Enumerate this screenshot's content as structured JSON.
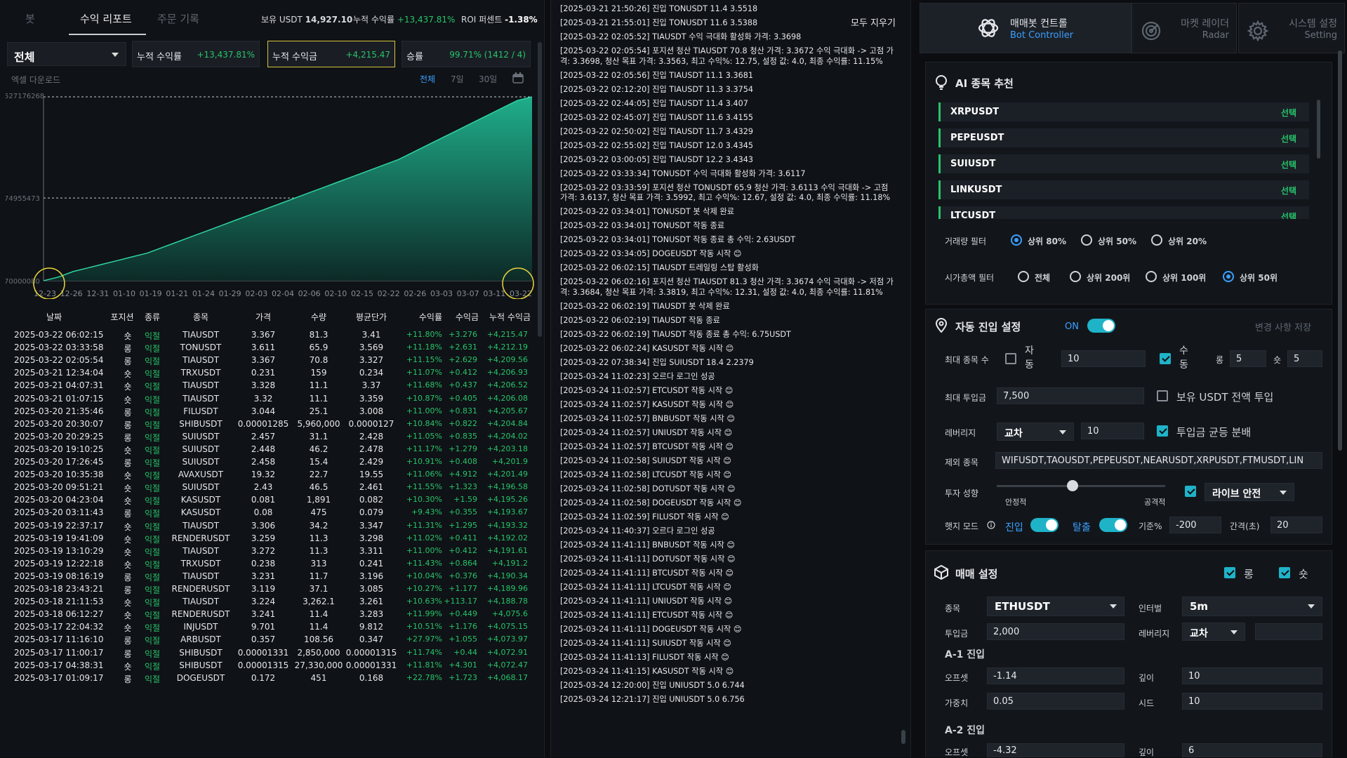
{
  "left": {
    "tabs": [
      "봇",
      "수익 리포트",
      "주문 기록"
    ],
    "summary": {
      "usdt_label": "보유 USDT",
      "usdt_value": "14,927.10",
      "cum_rate_label": "누적 수익률",
      "cum_rate_value": "+13,437.81%",
      "roi_label": "ROI 퍼센트",
      "roi_value": "-1.38%"
    },
    "filter_value": "전체",
    "stats": [
      {
        "label": "누적 수익률",
        "value": "+13,437.81%"
      },
      {
        "label": "누적 수익금",
        "value": "+4,215.47"
      },
      {
        "label": "승률",
        "value": "99.71% (1412 / 4)"
      }
    ],
    "excel_label": "엑셀 다운로드",
    "ranges": [
      "전체",
      "7일",
      "30일"
    ],
    "table_headers": [
      "날짜",
      "포지션",
      "종류",
      "종목",
      "가격",
      "수량",
      "평균단가",
      "수익률",
      "수익금",
      "누적 수익금"
    ],
    "rows": [
      [
        "2025-03-22 06:02:15",
        "숏",
        "익절",
        "TIAUSDT",
        "3.367",
        "81.3",
        "3.41",
        "+11.80%",
        "+3.276",
        "+4,215.47"
      ],
      [
        "2025-03-22 03:33:58",
        "롱",
        "익절",
        "TONUSDT",
        "3.611",
        "65.9",
        "3.569",
        "+11.18%",
        "+2.631",
        "+4,212.19"
      ],
      [
        "2025-03-22 02:05:54",
        "롱",
        "익절",
        "TIAUSDT",
        "3.367",
        "70.8",
        "3.327",
        "+11.15%",
        "+2.629",
        "+4,209.56"
      ],
      [
        "2025-03-21 12:34:04",
        "숏",
        "익절",
        "TRXUSDT",
        "0.231",
        "159",
        "0.234",
        "+11.07%",
        "+0.412",
        "+4,206.93"
      ],
      [
        "2025-03-21 04:07:31",
        "숏",
        "익절",
        "TIAUSDT",
        "3.328",
        "11.1",
        "3.37",
        "+11.68%",
        "+0.437",
        "+4,206.52"
      ],
      [
        "2025-03-21 01:07:15",
        "숏",
        "익절",
        "TIAUSDT",
        "3.32",
        "11.1",
        "3.359",
        "+10.87%",
        "+0.405",
        "+4,206.08"
      ],
      [
        "2025-03-20 21:35:46",
        "롱",
        "익절",
        "FILUSDT",
        "3.044",
        "25.1",
        "3.008",
        "+11.00%",
        "+0.831",
        "+4,205.67"
      ],
      [
        "2025-03-20 20:30:07",
        "롱",
        "익절",
        "SHIBUSDT",
        "0.00001285",
        "5,960,000",
        "0.0000127",
        "+10.84%",
        "+0.822",
        "+4,204.84"
      ],
      [
        "2025-03-20 20:29:25",
        "롱",
        "익절",
        "SUIUSDT",
        "2.457",
        "31.1",
        "2.428",
        "+11.05%",
        "+0.835",
        "+4,204.02"
      ],
      [
        "2025-03-20 19:10:25",
        "숏",
        "익절",
        "SUIUSDT",
        "2.448",
        "46.2",
        "2.478",
        "+11.17%",
        "+1.279",
        "+4,203.18"
      ],
      [
        "2025-03-20 17:26:45",
        "롱",
        "익절",
        "SUIUSDT",
        "2.458",
        "15.4",
        "2.429",
        "+10.91%",
        "+0.408",
        "+4,201.9"
      ],
      [
        "2025-03-20 10:35:38",
        "숏",
        "익절",
        "AVAXUSDT",
        "19.32",
        "22.7",
        "19.55",
        "+11.06%",
        "+4.912",
        "+4,201.49"
      ],
      [
        "2025-03-20 09:51:21",
        "숏",
        "익절",
        "SUIUSDT",
        "2.43",
        "46.5",
        "2.461",
        "+11.55%",
        "+1.323",
        "+4,196.58"
      ],
      [
        "2025-03-20 04:23:04",
        "숏",
        "익절",
        "KASUSDT",
        "0.081",
        "1,891",
        "0.082",
        "+10.30%",
        "+1.59",
        "+4,195.26"
      ],
      [
        "2025-03-20 03:11:43",
        "롱",
        "익절",
        "KASUSDT",
        "0.08",
        "475",
        "0.079",
        "+9.43%",
        "+0.355",
        "+4,193.67"
      ],
      [
        "2025-03-19 22:37:17",
        "숏",
        "익절",
        "TIAUSDT",
        "3.306",
        "34.2",
        "3.347",
        "+11.31%",
        "+1.295",
        "+4,193.32"
      ],
      [
        "2025-03-19 19:41:09",
        "숏",
        "익절",
        "RENDERUSDT",
        "3.259",
        "11.3",
        "3.298",
        "+11.02%",
        "+0.411",
        "+4,192.02"
      ],
      [
        "2025-03-19 13:10:29",
        "숏",
        "익절",
        "TIAUSDT",
        "3.272",
        "11.3",
        "3.311",
        "+11.00%",
        "+0.412",
        "+4,191.61"
      ],
      [
        "2025-03-19 12:22:18",
        "숏",
        "익절",
        "TRXUSDT",
        "0.238",
        "313",
        "0.241",
        "+11.43%",
        "+0.864",
        "+4,191.2"
      ],
      [
        "2025-03-19 08:16:19",
        "롱",
        "익절",
        "TIAUSDT",
        "3.231",
        "11.7",
        "3.196",
        "+10.04%",
        "+0.376",
        "+4,190.34"
      ],
      [
        "2025-03-18 23:43:21",
        "롱",
        "익절",
        "RENDERUSDT",
        "3.119",
        "37.1",
        "3.085",
        "+10.27%",
        "+1.177",
        "+4,189.96"
      ],
      [
        "2025-03-18 21:11:53",
        "숏",
        "익절",
        "TIAUSDT",
        "3.224",
        "3,262.1",
        "3.261",
        "+10.63%",
        "+113.17",
        "+4,188.78"
      ],
      [
        "2025-03-18 06:12:27",
        "숏",
        "익절",
        "RENDERUSDT",
        "3.241",
        "11.4",
        "3.283",
        "+11.99%",
        "+0.449",
        "+4,075.6"
      ],
      [
        "2025-03-17 22:04:32",
        "숏",
        "익절",
        "INJUSDT",
        "9.701",
        "11.4",
        "9.812",
        "+10.51%",
        "+1.176",
        "+4,075.15"
      ],
      [
        "2025-03-17 11:16:10",
        "롱",
        "익절",
        "ARBUSDT",
        "0.357",
        "108.56",
        "0.347",
        "+27.97%",
        "+1.055",
        "+4,073.97"
      ],
      [
        "2025-03-17 11:00:17",
        "롱",
        "익절",
        "SHIBUSDT",
        "0.00001331",
        "2,850,000",
        "0.00001315",
        "+11.74%",
        "+0.44",
        "+4,072.91"
      ],
      [
        "2025-03-17 04:38:31",
        "숏",
        "익절",
        "SHIBUSDT",
        "0.00001315",
        "27,330,000",
        "0.00001331",
        "+11.81%",
        "+4.301",
        "+4,072.47"
      ],
      [
        "2025-03-17 01:09:17",
        "롱",
        "익절",
        "DOGEUSDT",
        "0.172",
        "451",
        "0.168",
        "+22.78%",
        "+1.723",
        "+4,068.17"
      ]
    ]
  },
  "chart_data": {
    "type": "area",
    "title": "",
    "xlabel": "",
    "ylabel": "",
    "y_ticks": [
      "527176268",
      "74955473",
      "70000080"
    ],
    "ylim": [
      70000080,
      527176268
    ],
    "x_ticks": [
      "12-23",
      "12-26",
      "12-31",
      "01-10",
      "01-19",
      "01-21",
      "01-24",
      "01-29",
      "02-03",
      "02-04",
      "02-06",
      "02-10",
      "02-15",
      "02-22",
      "02-26",
      "03-03",
      "03-07",
      "03-11",
      "03-22"
    ],
    "values": [
      0.0,
      0.02,
      0.05,
      0.07,
      0.09,
      0.11,
      0.13,
      0.15,
      0.18,
      0.21,
      0.24,
      0.27,
      0.3,
      0.33,
      0.36,
      0.39,
      0.42,
      0.45,
      0.48,
      0.51,
      0.54,
      0.57,
      0.6,
      0.63,
      0.66,
      0.7,
      0.74,
      0.78,
      0.82,
      0.86,
      0.9,
      0.94,
      0.98,
      1.0
    ],
    "values_unit": "fraction of y range",
    "grid": true,
    "color": "#1fa383"
  },
  "mid": {
    "clear_label": "모두 지우기",
    "logs": [
      "[2025-03-21 21:50:26] 진입 TONUSDT 11.4 3.5518",
      "[2025-03-21 21:55:01] 진입 TONUSDT 11.6 3.5388",
      "[2025-03-22 02:05:52] TIAUSDT 수익 극대화 활성화 가격: 3.3698",
      "[2025-03-22 02:05:54] 포지션 청산 TIAUSDT 70.8 청산 가격: 3.3672 수익 극대화 -> 고점 가격: 3.3698, 청산 목표 가격: 3.3563, 최고 수익%: 12.75, 설정 값: 4.0, 최종 수익률: 11.15%",
      "[2025-03-22 02:05:56] 진입 TIAUSDT 11.1 3.3681",
      "[2025-03-22 02:12:20] 진입 TIAUSDT 11.3 3.3754",
      "[2025-03-22 02:44:05] 진입 TIAUSDT 11.4 3.407",
      "[2025-03-22 02:45:07] 진입 TIAUSDT 11.6 3.4155",
      "[2025-03-22 02:50:02] 진입 TIAUSDT 11.7 3.4329",
      "[2025-03-22 02:55:02] 진입 TIAUSDT 12.0 3.4345",
      "[2025-03-22 03:00:05] 진입 TIAUSDT 12.2 3.4343",
      "[2025-03-22 03:33:34] TONUSDT 수익 극대화 활성화 가격: 3.6117",
      "[2025-03-22 03:33:59] 포지션 청산 TONUSDT 65.9 청산 가격: 3.6113 수익 극대화 -> 고점 가격: 3.6137, 청산 목표 가격: 3.5992, 최고 수익%: 12.67, 설정 값: 4.0, 최종 수익률: 11.18%",
      "[2025-03-22 03:34:01] TONUSDT 봇 삭제 완료",
      "[2025-03-22 03:34:01] TONUSDT 작동 종료",
      "[2025-03-22 03:34:01] TONUSDT 작동 종료 총 수익: 2.63USDT",
      "[2025-03-22 03:34:05] DOGEUSDT 작동 시작 😊",
      "[2025-03-22 06:02:15] TIAUSDT 트레일링 스탑 활성화",
      "[2025-03-22 06:02:16] 포지션 청산 TIAUSDT 81.3 청산 가격: 3.3674 수익 극대화 -> 저점 가격: 3.3684, 청산 목표 가격: 3.3819, 최고 수익%: 12.31, 설정 값: 4.0, 최종 수익률: 11.81%",
      "[2025-03-22 06:02:19] TIAUSDT 봇 삭제 완료",
      "[2025-03-22 06:02:19] TIAUSDT 작동 종료",
      "[2025-03-22 06:02:19] TIAUSDT 작동 종료 총 수익: 6.75USDT",
      "[2025-03-22 06:02:24] KASUSDT 작동 시작 😊",
      "[2025-03-22 07:38:34] 진입 SUIUSDT 18.4 2.2379",
      "[2025-03-24 11:02:23] 오르다 로그인 성공",
      "[2025-03-24 11:02:57] ETCUSDT 작동 시작 😊",
      "[2025-03-24 11:02:57] KASUSDT 작동 시작 😊",
      "[2025-03-24 11:02:57] BNBUSDT 작동 시작 😊",
      "[2025-03-24 11:02:57] UNIUSDT 작동 시작 😊",
      "[2025-03-24 11:02:57] BTCUSDT 작동 시작 😊",
      "[2025-03-24 11:02:58] SUIUSDT 작동 시작 😊",
      "[2025-03-24 11:02:58] LTCUSDT 작동 시작 😊",
      "[2025-03-24 11:02:58] DOTUSDT 작동 시작 😊",
      "[2025-03-24 11:02:58] DOGEUSDT 작동 시작 😊",
      "[2025-03-24 11:02:59] FILUSDT 작동 시작 😊",
      "[2025-03-24 11:40:37] 오르다 로그인 성공",
      "[2025-03-24 11:41:11] BNBUSDT 작동 시작 😊",
      "[2025-03-24 11:41:11] DOTUSDT 작동 시작 😊",
      "[2025-03-24 11:41:11] BTCUSDT 작동 시작 😊",
      "[2025-03-24 11:41:11] LTCUSDT 작동 시작 😊",
      "[2025-03-24 11:41:11] UNIUSDT 작동 시작 😊",
      "[2025-03-24 11:41:11] ETCUSDT 작동 시작 😊",
      "[2025-03-24 11:41:11] DOGEUSDT 작동 시작 😊",
      "[2025-03-24 11:41:11] SUIUSDT 작동 시작 😊",
      "[2025-03-24 11:41:13] FILUSDT 작동 시작 😊",
      "[2025-03-24 11:41:15] KASUSDT 작동 시작 😊",
      "[2025-03-24 12:20:00] 진입 UNIUSDT 5.0 6.744",
      "[2025-03-24 12:21:17] 진입 UNIUSDT 5.0 6.756"
    ]
  },
  "right": {
    "tabs": [
      {
        "t1": "매매봇 컨트롤",
        "t2": "Bot Controller",
        "icon": "openai-icon"
      },
      {
        "t1": "마켓 레이더",
        "t2": "Radar",
        "icon": "radar-icon"
      },
      {
        "t1": "시스템 설정",
        "t2": "Setting",
        "icon": "gear-icon"
      }
    ],
    "ai": {
      "title": "AI 종목 추천",
      "items": [
        "XRPUSDT",
        "PEPEUSDT",
        "SUIUSDT",
        "LINKUSDT",
        "LTCUSDT"
      ],
      "select_label": "선택",
      "volume_filter_label": "거래량 필터",
      "volume_options": [
        "상위 80%",
        "상위 50%",
        "상위 20%"
      ],
      "mcap_filter_label": "시가총액 필터",
      "mcap_options": [
        "전체",
        "상위 200위",
        "상위 100위",
        "상위 50위"
      ]
    },
    "auto": {
      "title": "자동 진입 설정",
      "on_label": "ON",
      "save_label": "변경 사항 저장",
      "max_symbols_label": "최대 종목 수",
      "auto_label": "자동",
      "max_symbols_value": "10",
      "manual_label": "수동",
      "long_label": "롱",
      "long_value": "5",
      "short_label": "숏",
      "short_value": "5",
      "max_invest_label": "최대 투입금",
      "max_invest_value": "7,500",
      "all_usdt_label": "보유 USDT 전액 투입",
      "leverage_label": "레버리지",
      "leverage_mode": "교차",
      "leverage_value": "10",
      "even_split_label": "투입금 균등 분배",
      "exclude_label": "제외 종목",
      "exclude_value": "WIFUSDT,TAOUSDT,PEPEUSDT,NEARUSDT,XRPUSDT,FTMUSDT,LIN",
      "tendency_label": "투자 성향",
      "stable_label": "안정적",
      "aggressive_label": "공격적",
      "tendency_level": 0.45,
      "live_mode": "라이브 안전",
      "hedge_label": "햇지 모드",
      "entry_label": "진입",
      "exit_label": "탈출",
      "base_pct_label": "기준%",
      "base_pct_value": "-200",
      "interval_label": "간격(초)",
      "interval_value": "20"
    },
    "trade": {
      "title": "매매 설정",
      "long_label": "롱",
      "short_label": "숏",
      "symbol_label": "종목",
      "symbol_value": "ETHUSDT",
      "interval_label": "인터벌",
      "interval_value": "5m",
      "invest_label": "투입금",
      "invest_value": "2,000",
      "leverage_label": "레버리지",
      "leverage_value": "교차",
      "a1_label": "A-1 진입",
      "offset_label": "오프셋",
      "offset_value": "-1.14",
      "depth_label": "깊이",
      "depth_value": "10",
      "weight_label": "가중치",
      "weight_value": "0.05",
      "seed_label": "시드",
      "seed_value": "10",
      "a2_label": "A-2 진입",
      "offset2_value": "-4.32",
      "depth2_value": "6"
    }
  }
}
